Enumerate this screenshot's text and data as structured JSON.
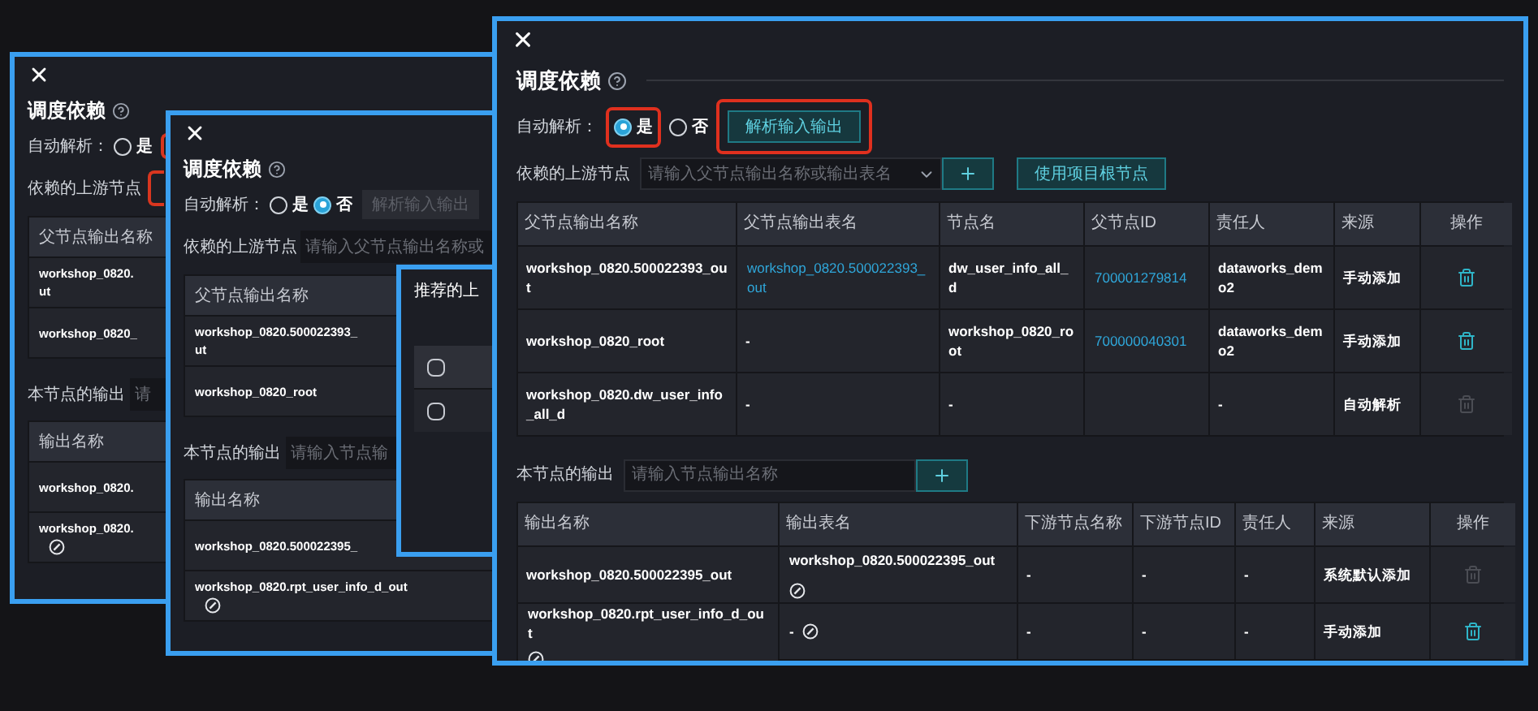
{
  "back_panels": [
    {
      "title": "调度依赖",
      "auto_parse": {
        "label": "自动解析：",
        "highlighted": true,
        "options": [
          {
            "label": "是",
            "selected": false
          }
        ]
      },
      "upstream": {
        "label": "依赖的上游节点",
        "highlighted": true
      },
      "upstream_table": {
        "columns": [
          "父节点输出名称"
        ],
        "rows": [
          {
            "lines": [
              "workshop_0820.",
              "ut"
            ]
          },
          {
            "lines": [
              "workshop_0820_"
            ]
          }
        ]
      },
      "output": {
        "label": "本节点的输出",
        "placeholder": "请"
      },
      "output_table": {
        "columns": [
          "输出名称"
        ],
        "rows": [
          {
            "lines": [
              "workshop_0820."
            ],
            "editable": false
          },
          {
            "lines": [
              "workshop_0820."
            ],
            "editable": true
          }
        ]
      }
    },
    {
      "title": "调度依赖",
      "auto_parse": {
        "label": "自动解析：",
        "highlighted": false,
        "options": [
          {
            "label": "是",
            "selected": false
          },
          {
            "label": "否",
            "selected": true
          }
        ],
        "button": {
          "label": "解析输入输出",
          "disabled": true
        }
      },
      "upstream": {
        "label": "依赖的上游节点",
        "highlighted": false,
        "placeholder": "请输入父节点输出名称或"
      },
      "upstream_table": {
        "columns": [
          "父节点输出名称"
        ],
        "rows": [
          {
            "lines": [
              "workshop_0820.500022393_",
              "ut"
            ]
          },
          {
            "lines": [
              "workshop_0820_root"
            ]
          }
        ]
      },
      "output": {
        "label": "本节点的输出",
        "placeholder": "请输入节点输"
      },
      "output_table": {
        "columns": [
          "输出名称"
        ],
        "rows": [
          {
            "lines": [
              "workshop_0820.500022395_"
            ],
            "editable": false
          },
          {
            "lines": [
              "workshop_0820.rpt_user_info_d_out"
            ],
            "editable": true
          }
        ]
      }
    }
  ],
  "recommend_panel": {
    "title": "推荐的上",
    "rows": [
      {
        "checked": false
      },
      {
        "checked": false
      }
    ]
  },
  "main_panel": {
    "title": "调度依赖",
    "auto_parse": {
      "label": "自动解析：",
      "options": [
        {
          "label": "是",
          "selected": true,
          "highlighted": true
        },
        {
          "label": "否",
          "selected": false,
          "highlighted": false
        }
      ],
      "button": {
        "label": "解析输入输出",
        "disabled": false,
        "highlighted": true
      }
    },
    "upstream": {
      "label": "依赖的上游节点",
      "placeholder": "请输入父节点输出名称或输出表名",
      "root_button": "使用项目根节点"
    },
    "upstream_table": {
      "columns": [
        "父节点输出名称",
        "父节点输出表名",
        "节点名",
        "父节点ID",
        "责任人",
        "来源",
        "操作"
      ],
      "rows": [
        {
          "cells": [
            {
              "text": "workshop_0820.500022393_out"
            },
            {
              "text": "workshop_0820.500022393_out",
              "link": true
            },
            {
              "text": "dw_user_info_all_d"
            },
            {
              "text": "700001279814",
              "link": true
            },
            {
              "text": "dataworks_demo2"
            },
            {
              "text": "手动添加"
            }
          ],
          "deletable": true
        },
        {
          "cells": [
            {
              "text": "workshop_0820_root"
            },
            {
              "text": "-"
            },
            {
              "text": "workshop_0820_root"
            },
            {
              "text": "700000040301",
              "link": true
            },
            {
              "text": "dataworks_demo2"
            },
            {
              "text": "手动添加"
            }
          ],
          "deletable": true
        },
        {
          "cells": [
            {
              "text": "workshop_0820.dw_user_info_all_d"
            },
            {
              "text": "-"
            },
            {
              "text": "-"
            },
            null,
            {
              "text": "-"
            },
            {
              "text": "自动解析"
            }
          ],
          "deletable": false
        }
      ]
    },
    "output": {
      "label": "本节点的输出",
      "placeholder": "请输入节点输出名称"
    },
    "output_table": {
      "columns": [
        "输出名称",
        "输出表名",
        "下游节点名称",
        "下游节点ID",
        "责任人",
        "来源",
        "操作"
      ],
      "rows": [
        {
          "cells": [
            {
              "text": "workshop_0820.500022395_out"
            },
            {
              "text": "workshop_0820.500022395_out",
              "editable": true
            },
            {
              "text": "-"
            },
            {
              "text": "-"
            },
            {
              "text": "-"
            },
            {
              "text": "系统默认添加"
            }
          ],
          "deletable": false
        },
        {
          "cells": [
            {
              "text": "workshop_0820.rpt_user_info_d_out",
              "editable": true
            },
            {
              "text": "-",
              "editable": true
            },
            {
              "text": "-"
            },
            {
              "text": "-"
            },
            {
              "text": "-"
            },
            {
              "text": "手动添加"
            }
          ],
          "deletable": true
        }
      ]
    }
  }
}
